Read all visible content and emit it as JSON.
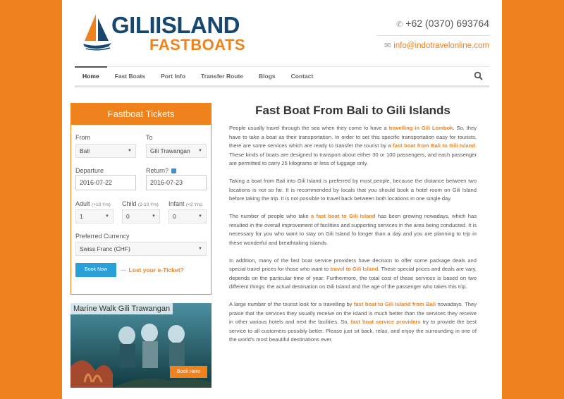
{
  "header": {
    "logo_top": "GILIISLAND",
    "logo_bottom": "FASTBOATS",
    "phone": "+62 (0370) 693764",
    "email": "info@indotravelonline.com"
  },
  "nav": {
    "items": [
      "Home",
      "Fast Boats",
      "Port Info",
      "Transfer Route",
      "Blogs",
      "Contact"
    ]
  },
  "booking": {
    "title": "Fastboat Tickets",
    "from_label": "From",
    "from_value": "Bali",
    "to_label": "To",
    "to_value": "Gili Trawangan",
    "departure_label": "Departure",
    "departure_value": "2016-07-22",
    "return_label": "Return?",
    "return_value": "2016-07-23",
    "adult_label": "Adult",
    "adult_note": "(+10 Yrs)",
    "adult_value": "1",
    "child_label": "Child",
    "child_note": "(2-10 Yrs)",
    "child_value": "0",
    "infant_label": "Infant",
    "infant_note": "(<2 Yrs)",
    "infant_value": "0",
    "currency_label": "Preferred Currency",
    "currency_value": "Swiss Franc (CHF)",
    "book_button": "Book Now",
    "lost_dash": "—",
    "lost_link": "Lost your e-Ticket?"
  },
  "promo": {
    "title": "Marine Walk Gili Trawangan",
    "button": "Book Here"
  },
  "article": {
    "title": "Fast Boat From Bali to Gili Islands",
    "p1": {
      "a": "People usually travel through the sea when they come to have a ",
      "link1": "travelling in Gili Lombok",
      "b": ". So, they have to take a boat as their transportation. In order to set this specific transportation easy for tourists, there are some services which are ready to transfer the tourist by a ",
      "link2": "fast boat from Bali to Gili Island",
      "c": ". These kinds of boats are designed to transport about either 30 or 100 passengers, and each passenger are permitted to carry 25 kilograms or less of luggage only."
    },
    "p2": "Taking a boat from Bali into Gili Island is preferred by most people, because the distance between two locations is not so far. It is recommended by locals that you should book a hotel room on Gili Island before taking the trip. It is not possible to travel back between both locations in one single day.",
    "p3": {
      "a": "The number of people who take ",
      "link1": "a fast boat to Gili Island",
      "b": " has been growing nowadays, which has resulted in the overall improvement of facilities and supporting services in the area being conducted. It is necessary for you who want to stay on Gili Island fo longer than a day and you are planning to trip in these wonderful and breathtaking islands."
    },
    "p4": {
      "a": "In addition, many of the fast boat service providers have decision to offer some package deals and special travel prices for those who want to ",
      "link1": "travel to Gili Island",
      "b": ". These special prices and deals are vary, depends on the particular time of year. Furthermore, the total cost of these services is based on two different things: the actual destination on Gili Island and the age of the passenger who takes this trip."
    },
    "p5": {
      "a": "A large number of the tourist look for a travelling by ",
      "link1": "fast boat to Gili Island from Bali",
      "b": " nowadays. They praise that the services they usually receive on the island is much better than the services they receive in other various hotels and next the facilities. So, ",
      "link2": "fast boat service providers",
      "c": " try to provide the best service to all customers possibly better. Please just sit back, relax, and enjoy the surrounding in one of the world's most beautiful destinations ever."
    }
  }
}
